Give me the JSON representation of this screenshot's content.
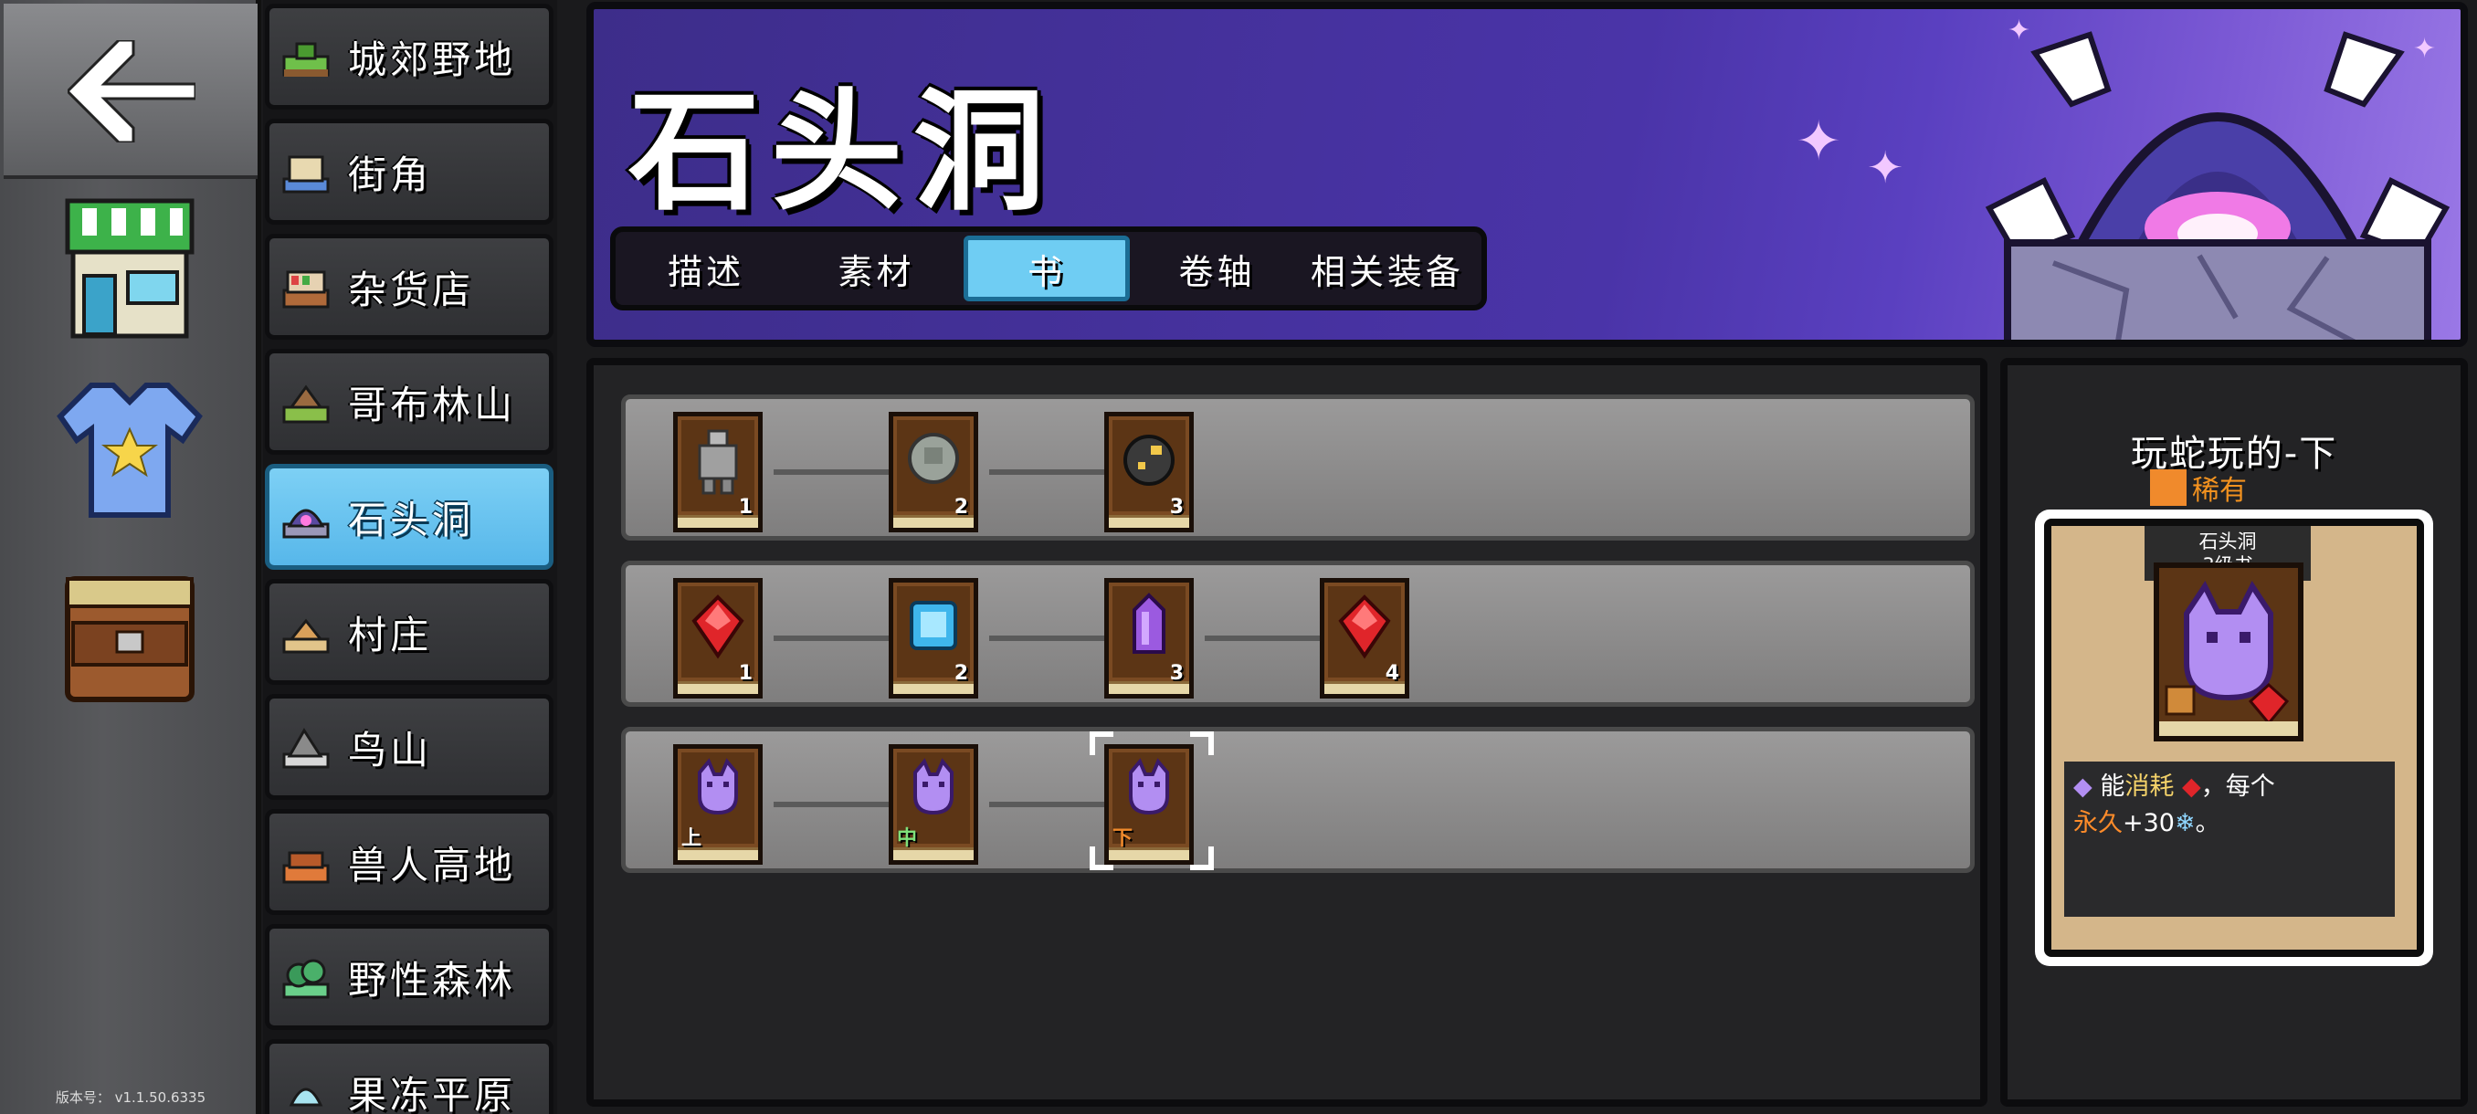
{
  "app": {
    "version": "版本号：  v1.1.50.6335"
  },
  "rail": {
    "items": [
      "back-icon",
      "shop-icon",
      "shirt-icon",
      "backpack-icon"
    ]
  },
  "locations": [
    {
      "label": "城郊野地",
      "icon": "grassland-icon"
    },
    {
      "label": "街角",
      "icon": "street-icon"
    },
    {
      "label": "杂货店",
      "icon": "grocery-icon"
    },
    {
      "label": "哥布林山",
      "icon": "goblin-hill-icon"
    },
    {
      "label": "石头洞",
      "icon": "stone-cave-icon",
      "selected": true
    },
    {
      "label": "村庄",
      "icon": "village-icon"
    },
    {
      "label": "鸟山",
      "icon": "bird-mountain-icon"
    },
    {
      "label": "兽人高地",
      "icon": "orc-highland-icon"
    },
    {
      "label": "野性森林",
      "icon": "wild-forest-icon"
    },
    {
      "label": "果冻平原",
      "icon": "jelly-plain-icon"
    }
  ],
  "header": {
    "title": "石头洞",
    "tabs": [
      "描述",
      "素材",
      "书",
      "卷轴",
      "相关装备"
    ],
    "active_tab": "书"
  },
  "rows": [
    {
      "books": [
        {
          "num": "1",
          "icon": "stone-golem-icon"
        },
        {
          "num": "2",
          "icon": "rock-golem-icon"
        },
        {
          "num": "3",
          "icon": "ore-golem-icon"
        }
      ]
    },
    {
      "books": [
        {
          "num": "1",
          "icon": "red-gem-icon"
        },
        {
          "num": "2",
          "icon": "blue-gem-icon"
        },
        {
          "num": "3",
          "icon": "purple-crystal-icon"
        },
        {
          "num": "4",
          "icon": "red-gem-icon"
        }
      ]
    },
    {
      "books": [
        {
          "num": "上",
          "icon": "snake-spirit-icon"
        },
        {
          "num": "中",
          "icon": "snake-spirit-icon"
        },
        {
          "num": "下",
          "icon": "snake-spirit-icon",
          "selected": true
        }
      ]
    }
  ],
  "detail": {
    "title": "玩蛇玩的-下",
    "rarity": "稀有",
    "rarity_color": "#f08a2c",
    "card_tag_line1": "石头洞",
    "card_tag_line2": "3级书",
    "desc_part1": "能",
    "desc_keyword": "消耗",
    "desc_part2": "，每个",
    "desc_keyword2": "永久",
    "desc_part3": "+30",
    "desc_end": "。"
  }
}
